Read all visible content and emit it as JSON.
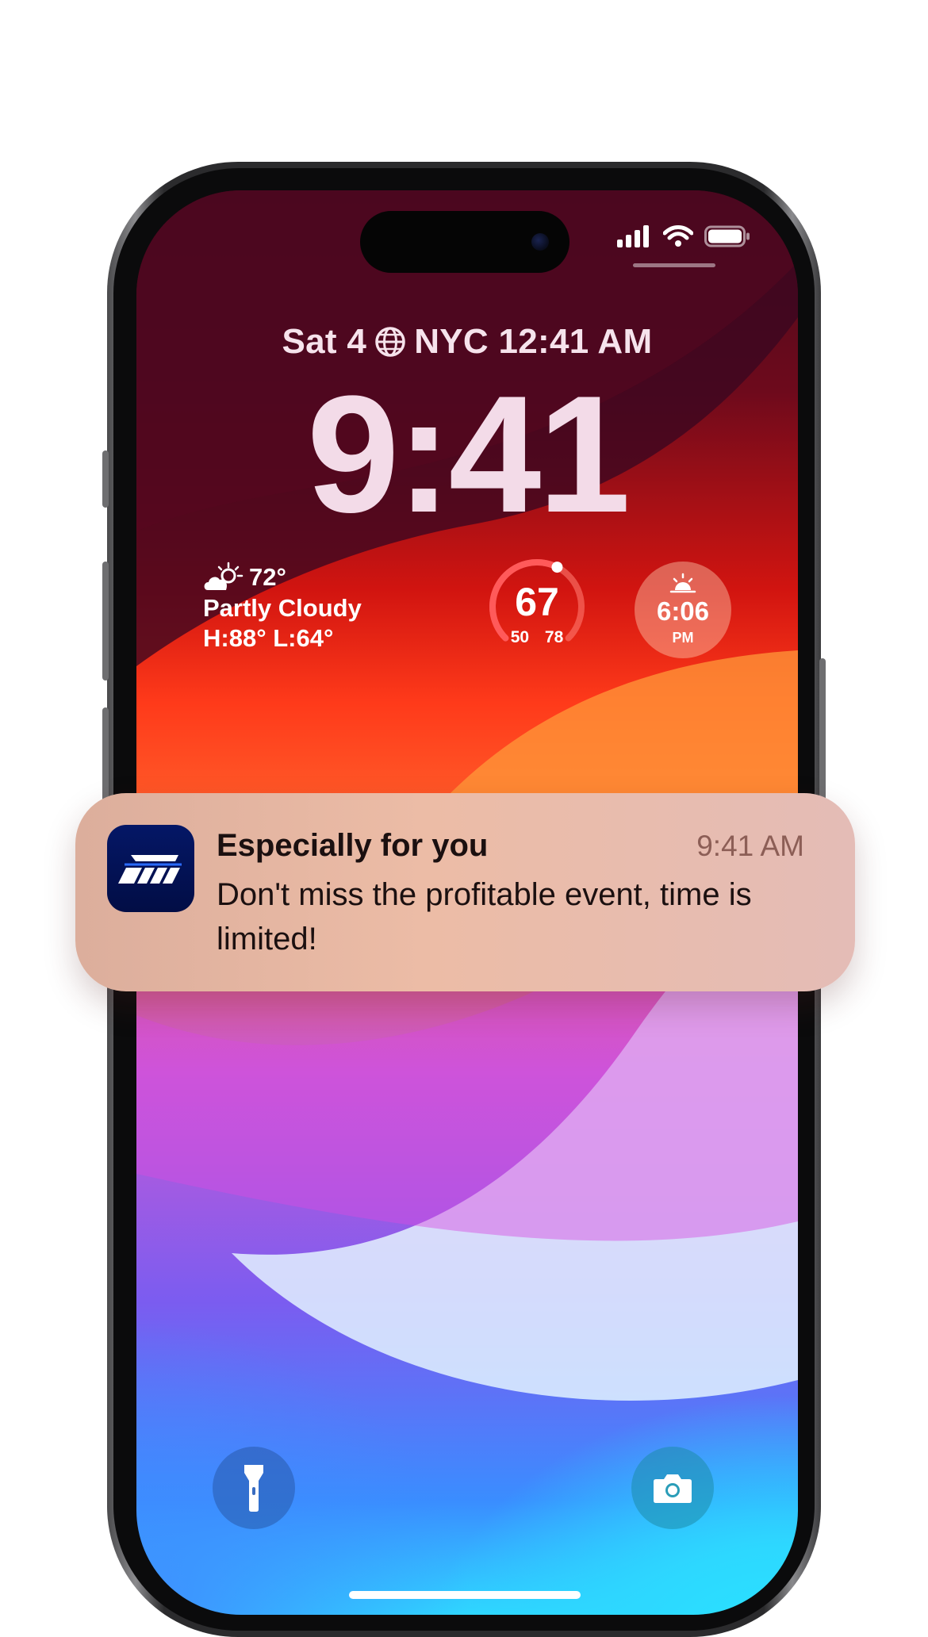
{
  "status_bar": {
    "signal_icon": "cellular-signal-icon",
    "wifi_icon": "wifi-icon",
    "battery_icon": "battery-icon"
  },
  "lock_screen": {
    "date_prefix": "Sat 4",
    "world_clock": "NYC 12:41 AM",
    "globe_icon": "globe-icon",
    "time": "9:41"
  },
  "widgets": {
    "weather": {
      "icon": "partly-cloudy-icon",
      "temperature": "72°",
      "condition": "Partly Cloudy",
      "high_low": "H:88° L:64°"
    },
    "temperature_gauge": {
      "current": "67",
      "range": "50 78",
      "level": 0.6
    },
    "sunset": {
      "icon": "sunset-icon",
      "time": "6:06",
      "ampm": "PM"
    }
  },
  "notification": {
    "app_icon": "app-logo-icon",
    "title": "Especially for you",
    "time": "9:41 AM",
    "body": "Don't miss the profitable event, time is limited!"
  },
  "quick_actions": {
    "flashlight_icon": "flashlight-icon",
    "camera_icon": "camera-icon"
  },
  "colors": {
    "notification_bg": "#ecbca6",
    "app_icon_bg": "#041766",
    "clock_text": "#f3dbe8"
  }
}
